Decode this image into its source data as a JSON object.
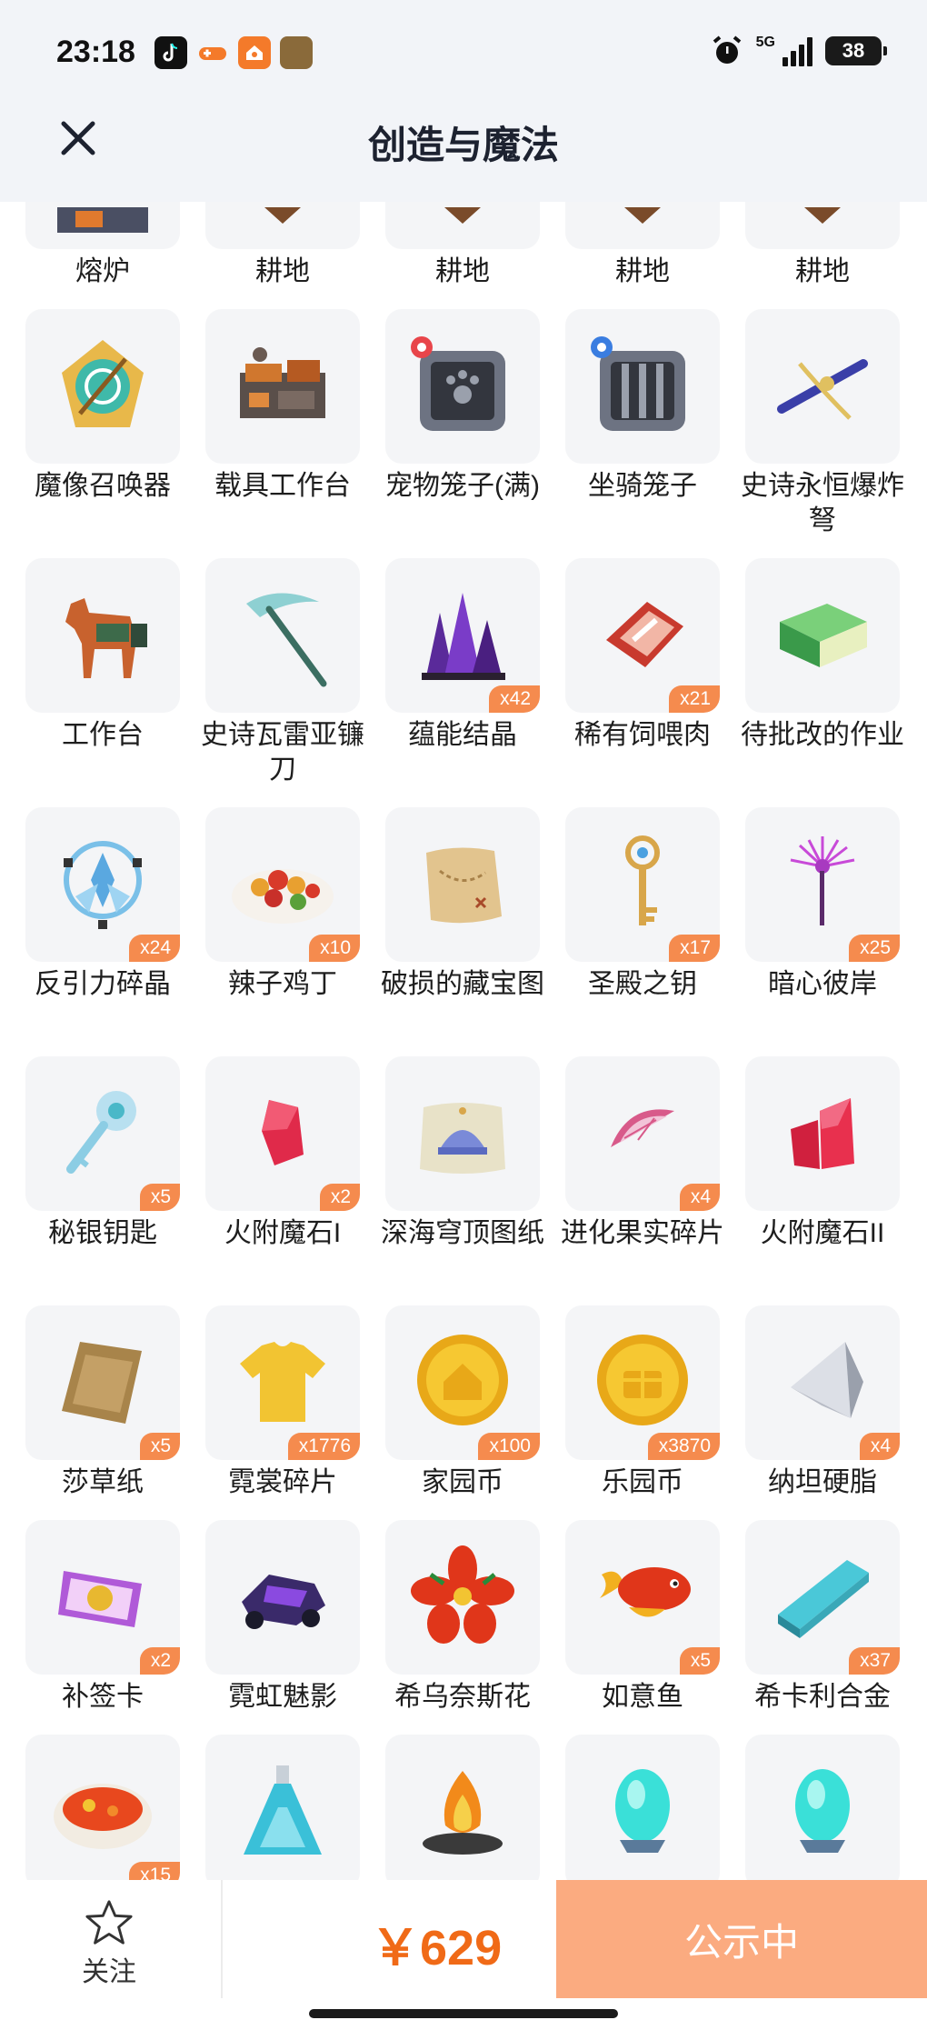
{
  "status_bar": {
    "time": "23:18",
    "network": "5G",
    "battery": "38"
  },
  "header": {
    "title": "创造与魔法"
  },
  "grid": {
    "top_row": [
      {
        "name": "熔炉",
        "qty": ""
      },
      {
        "name": "耕地",
        "qty": ""
      },
      {
        "name": "耕地",
        "qty": ""
      },
      {
        "name": "耕地",
        "qty": ""
      },
      {
        "name": "耕地",
        "qty": ""
      }
    ],
    "rows": [
      [
        {
          "name": "魔像召唤器",
          "qty": "",
          "icon": "golem-summoner-icon"
        },
        {
          "name": "载具工作台",
          "qty": "",
          "icon": "vehicle-workbench-icon"
        },
        {
          "name": "宠物笼子(满)",
          "qty": "",
          "icon": "pet-cage-icon"
        },
        {
          "name": "坐骑笼子",
          "qty": "",
          "icon": "mount-cage-icon"
        },
        {
          "name": "史诗永恒爆炸弩",
          "qty": "",
          "icon": "crossbow-icon"
        }
      ],
      [
        {
          "name": "工作台",
          "qty": "",
          "icon": "workbench-horse-icon"
        },
        {
          "name": "史诗瓦雷亚镰刀",
          "qty": "",
          "icon": "scythe-icon"
        },
        {
          "name": "蕴能结晶",
          "qty": "x42",
          "icon": "crystal-icon"
        },
        {
          "name": "稀有饲喂肉",
          "qty": "x21",
          "icon": "meat-icon"
        },
        {
          "name": "待批改的作业",
          "qty": "",
          "icon": "homework-icon"
        }
      ],
      [
        {
          "name": "反引力碎晶",
          "qty": "x24",
          "icon": "antigravity-shard-icon"
        },
        {
          "name": "辣子鸡丁",
          "qty": "x10",
          "icon": "spicy-chicken-icon"
        },
        {
          "name": "破损的藏宝图",
          "qty": "",
          "icon": "treasure-map-icon"
        },
        {
          "name": "圣殿之钥",
          "qty": "x17",
          "icon": "temple-key-icon"
        },
        {
          "name": "暗心彼岸",
          "qty": "x25",
          "icon": "spider-lily-icon"
        }
      ],
      [
        {
          "name": "秘银钥匙",
          "qty": "x5",
          "icon": "mithril-key-icon"
        },
        {
          "name": "火附魔石I",
          "qty": "x2",
          "icon": "fire-gem-icon"
        },
        {
          "name": "深海穹顶图纸",
          "qty": "",
          "icon": "blueprint-icon"
        },
        {
          "name": "进化果实碎片",
          "qty": "x4",
          "icon": "fruit-shard-icon"
        },
        {
          "name": "火附魔石II",
          "qty": "",
          "icon": "fire-gem-2-icon"
        }
      ],
      [
        {
          "name": "莎草纸",
          "qty": "x5",
          "icon": "papyrus-icon"
        },
        {
          "name": "霓裳碎片",
          "qty": "x1776",
          "icon": "tshirt-icon"
        },
        {
          "name": "家园币",
          "qty": "x100",
          "icon": "home-coin-icon"
        },
        {
          "name": "乐园币",
          "qty": "x3870",
          "icon": "park-coin-icon"
        },
        {
          "name": "纳坦硬脂",
          "qty": "x4",
          "icon": "pyramid-icon"
        }
      ],
      [
        {
          "name": "补签卡",
          "qty": "x2",
          "icon": "ticket-icon"
        },
        {
          "name": "霓虹魅影",
          "qty": "",
          "icon": "neon-vehicle-icon"
        },
        {
          "name": "希乌奈斯花",
          "qty": "",
          "icon": "red-flower-icon"
        },
        {
          "name": "如意鱼",
          "qty": "x5",
          "icon": "koi-fish-icon"
        },
        {
          "name": "希卡利合金",
          "qty": "x37",
          "icon": "alloy-bar-icon"
        }
      ],
      [
        {
          "name": "",
          "qty": "x15",
          "icon": "soup-bowl-icon"
        },
        {
          "name": "",
          "qty": "",
          "icon": "potion-icon"
        },
        {
          "name": "",
          "qty": "",
          "icon": "campfire-icon"
        },
        {
          "name": "",
          "qty": "",
          "icon": "teal-egg-icon"
        },
        {
          "name": "",
          "qty": "",
          "icon": "teal-egg-icon"
        }
      ]
    ]
  },
  "bottom_bar": {
    "follow_label": "关注",
    "price": "￥629",
    "status_button": "公示中"
  },
  "colors": {
    "accent": "#f06a17",
    "button": "#fbab80",
    "badge": "#f58b4e"
  }
}
